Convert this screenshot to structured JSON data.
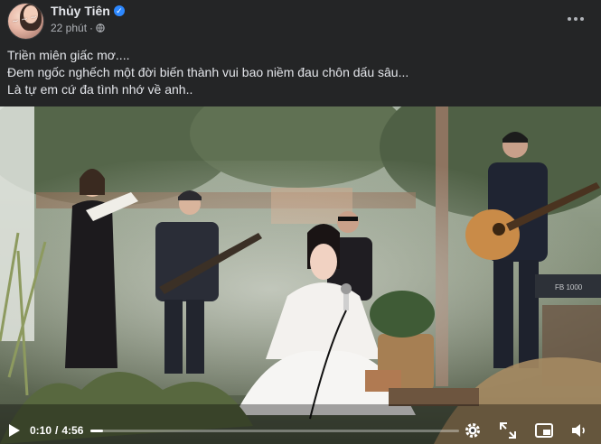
{
  "post": {
    "author": "Thủy Tiên",
    "verified": true,
    "time": "22 phút",
    "separator": "·",
    "privacy_icon": "globe-icon",
    "more_icon": "more-options-icon"
  },
  "caption": {
    "lines": [
      "Triền miên giấc mơ....",
      "Đem ngốc nghếch một đời biến thành vui bao niềm đau chôn dấu sâu...",
      "Là tự em cứ đa tình nhớ về anh.."
    ]
  },
  "video": {
    "current_time": "0:10",
    "separator": "/",
    "duration": "4:56",
    "progress_fraction": 0.034,
    "amp_label": "FB 1000",
    "icons": [
      "play-icon",
      "settings-gear-icon",
      "fullscreen-expand-icon",
      "picture-in-picture-icon",
      "volume-icon"
    ]
  },
  "colors": {
    "background": "#242526",
    "text_primary": "#e4e6eb",
    "text_secondary": "#b0b3b8",
    "verified_blue": "#2d88ff"
  }
}
